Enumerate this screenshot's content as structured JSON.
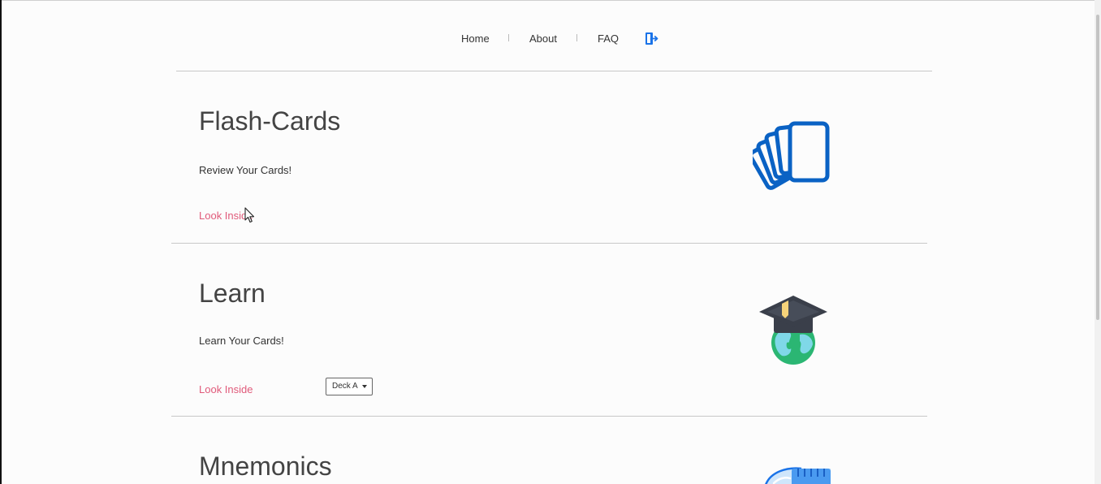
{
  "nav": {
    "items": [
      {
        "label": "Home"
      },
      {
        "label": "About"
      },
      {
        "label": "FAQ"
      }
    ],
    "logout_icon": "logout-door-icon",
    "accent_color": "#1a73e8"
  },
  "sections": [
    {
      "title": "Flash-Cards",
      "description": "Review Your Cards!",
      "link": "Look Inside",
      "icon": "flash-cards-icon"
    },
    {
      "title": "Learn",
      "description": "Learn Your Cards!",
      "link": "Look Inside",
      "deck_select": "Deck A",
      "icon": "graduation-globe-icon"
    },
    {
      "title": "Mnemonics",
      "icon": "mnemonics-icon"
    }
  ],
  "colors": {
    "link": "#e05a7a",
    "card_icon_blue": "#0a62c4",
    "text": "#333333"
  }
}
